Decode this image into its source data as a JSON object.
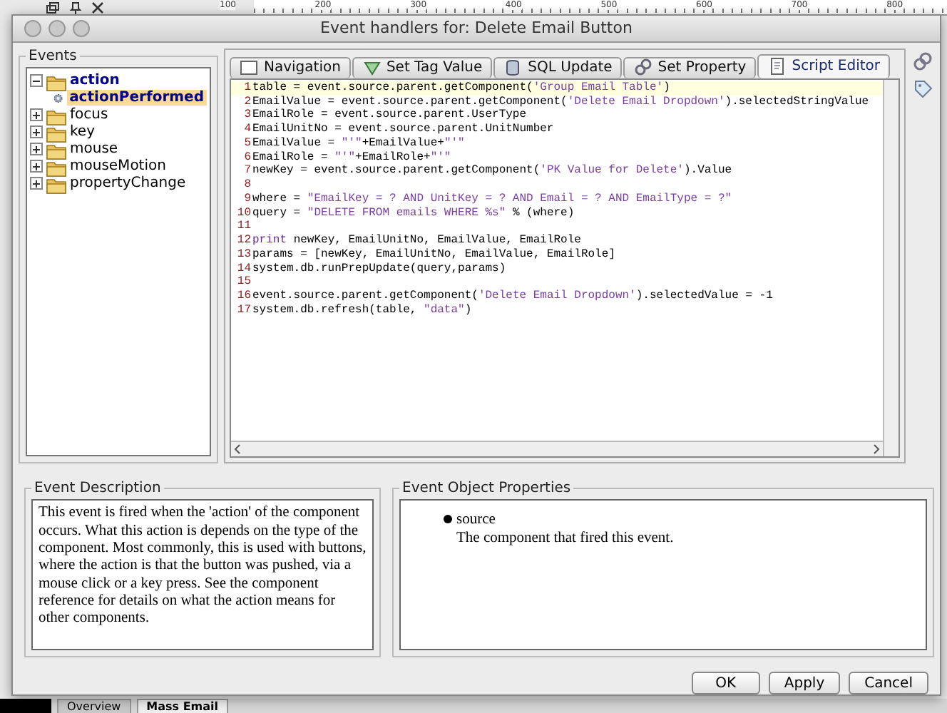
{
  "background": {
    "ruler_labels": [
      "100",
      "200",
      "300",
      "400",
      "500",
      "600",
      "700",
      "800"
    ],
    "taskbar_tabs": [
      {
        "label": "Overview",
        "selected": false
      },
      {
        "label": "Mass Email",
        "selected": true
      }
    ]
  },
  "window": {
    "title": "Event handlers for: Delete Email Button"
  },
  "events": {
    "title": "Events",
    "items": [
      {
        "label": "action",
        "expanded": true,
        "selected": false,
        "children": [
          {
            "label": "actionPerformed",
            "selected": true
          }
        ]
      },
      {
        "label": "focus",
        "expanded": false,
        "selected": false
      },
      {
        "label": "key",
        "expanded": false,
        "selected": false
      },
      {
        "label": "mouse",
        "expanded": false,
        "selected": false
      },
      {
        "label": "mouseMotion",
        "expanded": false,
        "selected": false
      },
      {
        "label": "propertyChange",
        "expanded": false,
        "selected": false
      }
    ]
  },
  "tabs": [
    {
      "label": "Navigation",
      "selected": false
    },
    {
      "label": "Set Tag Value",
      "selected": false
    },
    {
      "label": "SQL Update",
      "selected": false
    },
    {
      "label": "Set Property",
      "selected": false
    },
    {
      "label": "Script Editor",
      "selected": true
    }
  ],
  "code_lines": [
    {
      "number": "1",
      "segments": [
        {
          "kind": "plain",
          "text": "table = event.source.parent.getComponent("
        },
        {
          "kind": "string",
          "text": "'Group Email Table'"
        },
        {
          "kind": "plain",
          "text": ")"
        }
      ]
    },
    {
      "number": "2",
      "segments": [
        {
          "kind": "plain",
          "text": "EmailValue = event.source.parent.getComponent("
        },
        {
          "kind": "string",
          "text": "'Delete Email Dropdown'"
        },
        {
          "kind": "plain",
          "text": ").selectedStringValue"
        }
      ]
    },
    {
      "number": "3",
      "segments": [
        {
          "kind": "plain",
          "text": "EmailRole = event.source.parent.UserType"
        }
      ]
    },
    {
      "number": "4",
      "segments": [
        {
          "kind": "plain",
          "text": "EmailUnitNo = event.source.parent.UnitNumber"
        }
      ]
    },
    {
      "number": "5",
      "segments": [
        {
          "kind": "plain",
          "text": "EmailValue = "
        },
        {
          "kind": "string",
          "text": "\"'\""
        },
        {
          "kind": "plain",
          "text": "+EmailValue+"
        },
        {
          "kind": "string",
          "text": "\"'\""
        }
      ]
    },
    {
      "number": "6",
      "segments": [
        {
          "kind": "plain",
          "text": "EmailRole = "
        },
        {
          "kind": "string",
          "text": "\"'\""
        },
        {
          "kind": "plain",
          "text": "+EmailRole+"
        },
        {
          "kind": "string",
          "text": "\"'\""
        }
      ]
    },
    {
      "number": "7",
      "segments": [
        {
          "kind": "plain",
          "text": "newKey = event.source.parent.getComponent("
        },
        {
          "kind": "string",
          "text": "'PK Value for Delete'"
        },
        {
          "kind": "plain",
          "text": ").Value"
        }
      ]
    },
    {
      "number": "8"
    },
    {
      "number": "9",
      "segments": [
        {
          "kind": "plain",
          "text": "where = "
        },
        {
          "kind": "string",
          "text": "\"EmailKey = ? AND UnitKey = ? AND Email = ? AND EmailType = ?\""
        }
      ]
    },
    {
      "number": "10",
      "segments": [
        {
          "kind": "plain",
          "text": "query = "
        },
        {
          "kind": "string",
          "text": "\"DELETE FROM emails WHERE %s\""
        },
        {
          "kind": "plain",
          "text": " % (where)"
        }
      ]
    },
    {
      "number": "11"
    },
    {
      "number": "12",
      "segments": [
        {
          "kind": "keyword",
          "text": "print"
        },
        {
          "kind": "plain",
          "text": " newKey, EmailUnitNo, EmailValue, EmailRole"
        }
      ]
    },
    {
      "number": "13",
      "segments": [
        {
          "kind": "plain",
          "text": "params = [newKey, EmailUnitNo, EmailValue, EmailRole]"
        }
      ]
    },
    {
      "number": "14",
      "segments": [
        {
          "kind": "plain",
          "text": "system.db.runPrepUpdate(query,params)"
        }
      ]
    },
    {
      "number": "15"
    },
    {
      "number": "16",
      "segments": [
        {
          "kind": "plain",
          "text": "event.source.parent.getComponent("
        },
        {
          "kind": "string",
          "text": "'Delete Email Dropdown'"
        },
        {
          "kind": "plain",
          "text": ").selectedValue = -1"
        }
      ]
    },
    {
      "number": "17",
      "segments": [
        {
          "kind": "plain",
          "text": "system.db.refresh(table, "
        },
        {
          "kind": "string",
          "text": "\"data\""
        },
        {
          "kind": "plain",
          "text": ")"
        }
      ]
    }
  ],
  "description": {
    "title": "Event Description",
    "text": "This event is fired when the 'action' of the component occurs. What this action is depends on the type of the component. Most commonly, this is used with buttons, where the action is that the button was pushed, via a mouse click or a key press. See the component reference for details on what the action means for other components."
  },
  "properties": {
    "title": "Event Object Properties",
    "items": [
      {
        "name": "source",
        "description": "The component that fired this event."
      }
    ]
  },
  "buttons": [
    {
      "label": "OK"
    },
    {
      "label": "Apply"
    },
    {
      "label": "Cancel"
    }
  ]
}
